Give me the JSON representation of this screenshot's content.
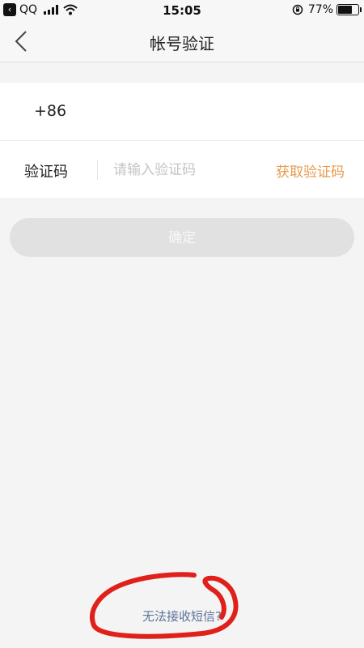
{
  "status_bar": {
    "back_app": "QQ",
    "time": "15:05",
    "battery_percent": "77%",
    "battery_level": 0.77
  },
  "nav": {
    "title": "帐号验证"
  },
  "form": {
    "country_code": "+86",
    "phone_value": "",
    "code_label": "验证码",
    "code_placeholder": "请输入验证码",
    "get_code_label": "获取验证码"
  },
  "confirm_label": "确定",
  "no_sms_link": "无法接收短信?",
  "colors": {
    "accent_orange": "#e79a4e",
    "link_blue": "#5b7497",
    "annotation_red": "#e0201a",
    "disabled_button": "#e1e1e1"
  }
}
